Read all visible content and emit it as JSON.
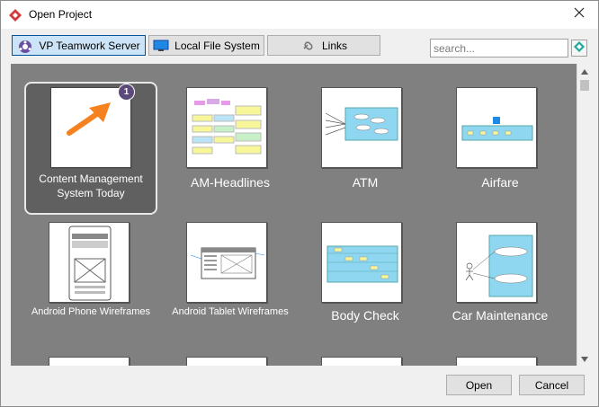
{
  "window": {
    "title": "Open Project",
    "app_icon": "visual-paradigm-logo-icon"
  },
  "toolbar": {
    "tabs": [
      {
        "label": "VP Teamwork Server",
        "icon": "teamwork-server-icon",
        "active": true
      },
      {
        "label": "Local File System",
        "icon": "monitor-icon",
        "active": false
      },
      {
        "label": "Links",
        "icon": "link-icon",
        "active": false
      }
    ],
    "search_placeholder": "search..."
  },
  "projects": [
    {
      "name": "Content Management System Today",
      "selected": true,
      "badge": "1"
    },
    {
      "name": "AM-Headlines",
      "selected": false
    },
    {
      "name": "ATM",
      "selected": false
    },
    {
      "name": "Airfare",
      "selected": false
    },
    {
      "name": "Android Phone Wireframes",
      "selected": false
    },
    {
      "name": "Android Tablet Wireframes",
      "selected": false
    },
    {
      "name": "Body Check",
      "selected": false
    },
    {
      "name": "Car Maintenance",
      "selected": false
    }
  ],
  "footer": {
    "open_label": "Open",
    "cancel_label": "Cancel"
  },
  "colors": {
    "accent": "#005499",
    "gallery_bg": "#808080",
    "badge": "#5b4a7a",
    "arrow": "#f5821f"
  }
}
